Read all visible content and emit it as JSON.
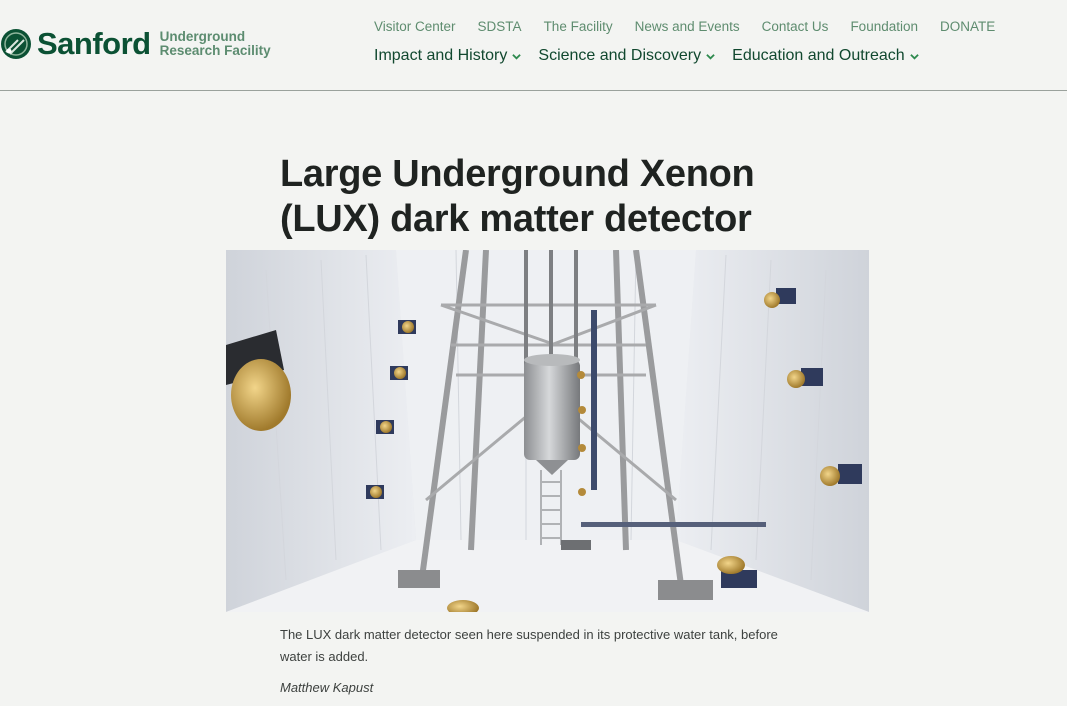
{
  "brand": {
    "name": "Sanford",
    "subtitle_line1": "Underground",
    "subtitle_line2": "Research Facility",
    "color": "#0b5134"
  },
  "utility_nav": {
    "items": [
      "Visitor Center",
      "SDSTA",
      "The Facility",
      "News and Events",
      "Contact Us",
      "Foundation",
      "DONATE"
    ]
  },
  "main_nav": {
    "items": [
      {
        "label": "Impact and History",
        "icon": "chevron-down-icon"
      },
      {
        "label": "Science and Discovery",
        "icon": "chevron-down-icon"
      },
      {
        "label": "Education and Outreach",
        "icon": "chevron-down-icon"
      }
    ]
  },
  "article": {
    "title_line1": "Large Underground Xenon",
    "title_line2": "(LUX) dark matter detector",
    "image_subject": "LUX detector suspended in water tank",
    "caption_line1": "The LUX dark matter detector seen here suspended in its protective water tank, before",
    "caption_line2": "water is added.",
    "credit": "Matthew Kapust"
  },
  "colors": {
    "background": "#f3f4f2",
    "utility_link": "#5e8c6f",
    "main_link": "#11482f",
    "chevron": "#2e8a4e"
  }
}
